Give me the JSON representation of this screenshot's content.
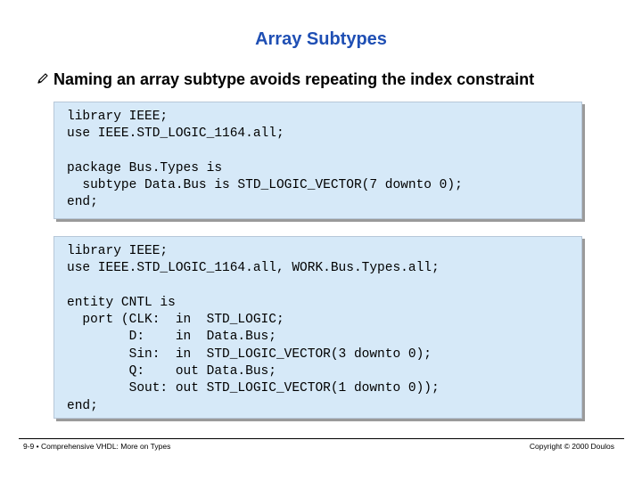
{
  "slide": {
    "title": "Array Subtypes",
    "bullet_icon": "pencil-icon",
    "bullet_text": "Naming an array subtype avoids repeating the index constraint"
  },
  "code_blocks": [
    {
      "lines": [
        "library IEEE;",
        "use IEEE.STD_LOGIC_1164.all;",
        "",
        "package Bus.Types is",
        "  subtype Data.Bus is STD_LOGIC_VECTOR(7 downto 0);",
        "end;"
      ]
    },
    {
      "lines": [
        "library IEEE;",
        "use IEEE.STD_LOGIC_1164.all, WORK.Bus.Types.all;",
        "",
        "entity CNTL is",
        "  port (CLK:  in  STD_LOGIC;",
        "        D:    in  Data.Bus;",
        "        Sin:  in  STD_LOGIC_VECTOR(3 downto 0);",
        "        Q:    out Data.Bus;",
        "        Sout: out STD_LOGIC_VECTOR(1 downto 0));",
        "end;"
      ]
    }
  ],
  "footer": {
    "left": "9-9 • Comprehensive VHDL: More on Types",
    "right": "Copyright © 2000 Doulos"
  },
  "colors": {
    "title": "#1f4fb4",
    "code_background": "#d6e9f8",
    "code_shadow": "#9a9a9a"
  }
}
